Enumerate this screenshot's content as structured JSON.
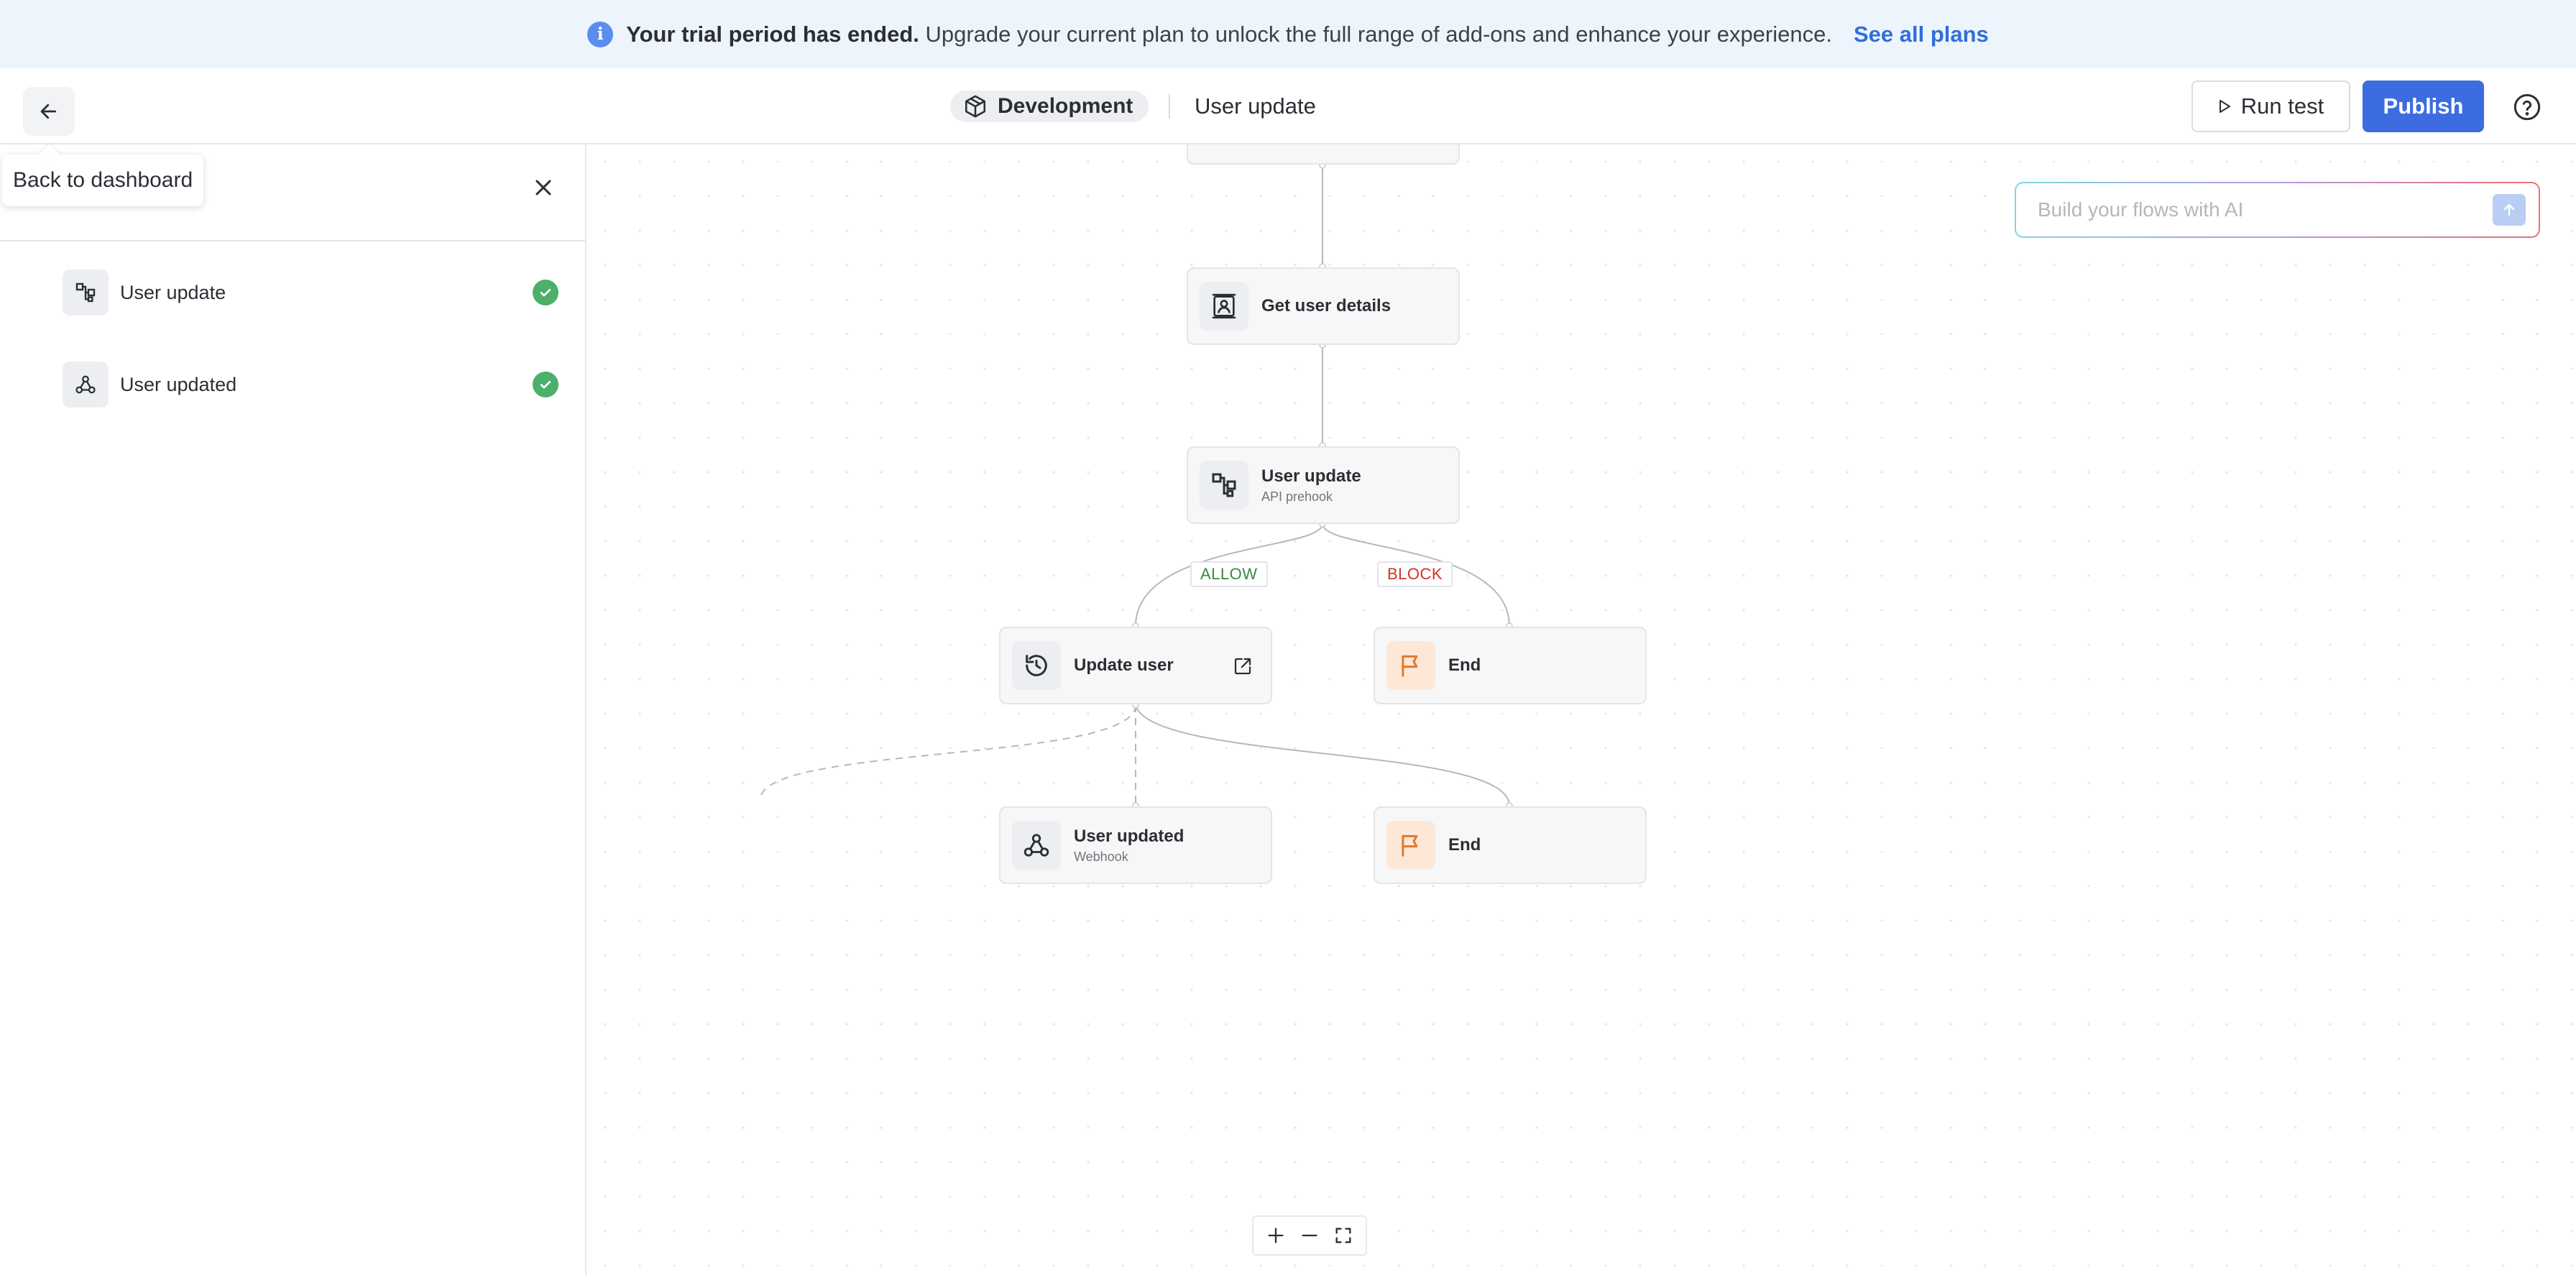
{
  "banner": {
    "bold_text": "Your trial period has ended.",
    "text": " Upgrade your current plan to unlock the full range of add-ons and enhance your experience.",
    "link": "See all plans"
  },
  "header": {
    "environment": "Development",
    "flow_name": "User update",
    "run_test_label": "Run test",
    "publish_label": "Publish"
  },
  "tooltip": "Back to dashboard",
  "sidebar": {
    "items": [
      {
        "label": "User update",
        "icon": "api-prehook-icon",
        "status": "complete"
      },
      {
        "label": "User updated",
        "icon": "webhook-icon",
        "status": "complete"
      }
    ]
  },
  "ai": {
    "placeholder": "Build your flows with AI"
  },
  "nodes": {
    "get_user_details": {
      "title": "Get user details"
    },
    "user_update": {
      "title": "User update",
      "subtitle": "API prehook"
    },
    "update_user": {
      "title": "Update user"
    },
    "end_block": {
      "title": "End"
    },
    "user_updated": {
      "title": "User updated",
      "subtitle": "Webhook"
    },
    "end_2": {
      "title": "End"
    }
  },
  "branches": {
    "allow": "ALLOW",
    "block": "BLOCK"
  },
  "colors": {
    "accent": "#3c6ce0",
    "allow": "#3c8a3c",
    "block": "#d0342c",
    "success": "#4caf6a",
    "end_icon": "#e07a2e"
  }
}
